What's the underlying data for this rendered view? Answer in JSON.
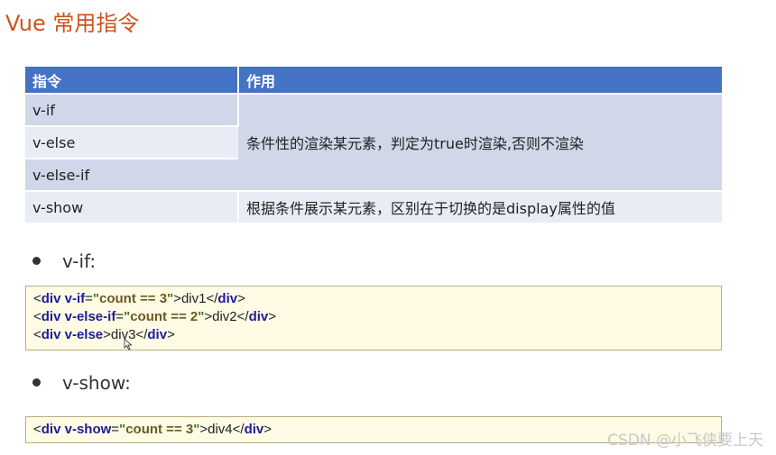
{
  "title": "Vue 常用指令",
  "table": {
    "headers": [
      "指令",
      "作用"
    ],
    "rows": [
      {
        "directive": "v-if"
      },
      {
        "directive": "v-else"
      },
      {
        "directive": "v-else-if"
      },
      {
        "directive": "v-show",
        "effect": "根据条件展示某元素，区别在于切换的是display属性的值"
      }
    ],
    "merged_effect": "条件性的渲染某元素，判定为true时渲染,否则不渲染"
  },
  "sections": [
    {
      "label": "v-if:"
    },
    {
      "label": "v-show:"
    }
  ],
  "code_vif": {
    "line1": {
      "open": "<",
      "tag": "div",
      "attr": " v-if",
      "eq": "=",
      "q1": "\"",
      "value": "count == 3",
      "q2": "\"",
      "gt": ">",
      "text": "div1",
      "close_open": "</",
      "close_tag": "div",
      "close_gt": ">"
    },
    "line2": {
      "open": "<",
      "tag": "div",
      "attr": " v-else-if",
      "eq": "=",
      "q1": "\"",
      "value": "count == 2",
      "q2": "\"",
      "gt": ">",
      "text": "div2",
      "close_open": "</",
      "close_tag": "div",
      "close_gt": ">"
    },
    "line3": {
      "open": "<",
      "tag": "div",
      "attr": " v-else",
      "gt": ">",
      "text": "div3",
      "close_open": "</",
      "close_tag": "div",
      "close_gt": ">"
    }
  },
  "code_vshow": {
    "line1": {
      "open": "<",
      "tag": "div",
      "attr": " v-show",
      "eq": "=",
      "q1": "\"",
      "value": "count == 3",
      "q2": "\"",
      "gt": ">",
      "text": "div4",
      "close_open": "</",
      "close_tag": "div",
      "close_gt": ">"
    }
  },
  "watermark": "CSDN @小飞侠要上天",
  "colors": {
    "title": "#d0521f",
    "header_bg": "#4472c4",
    "code_bg": "#fffbe4"
  }
}
